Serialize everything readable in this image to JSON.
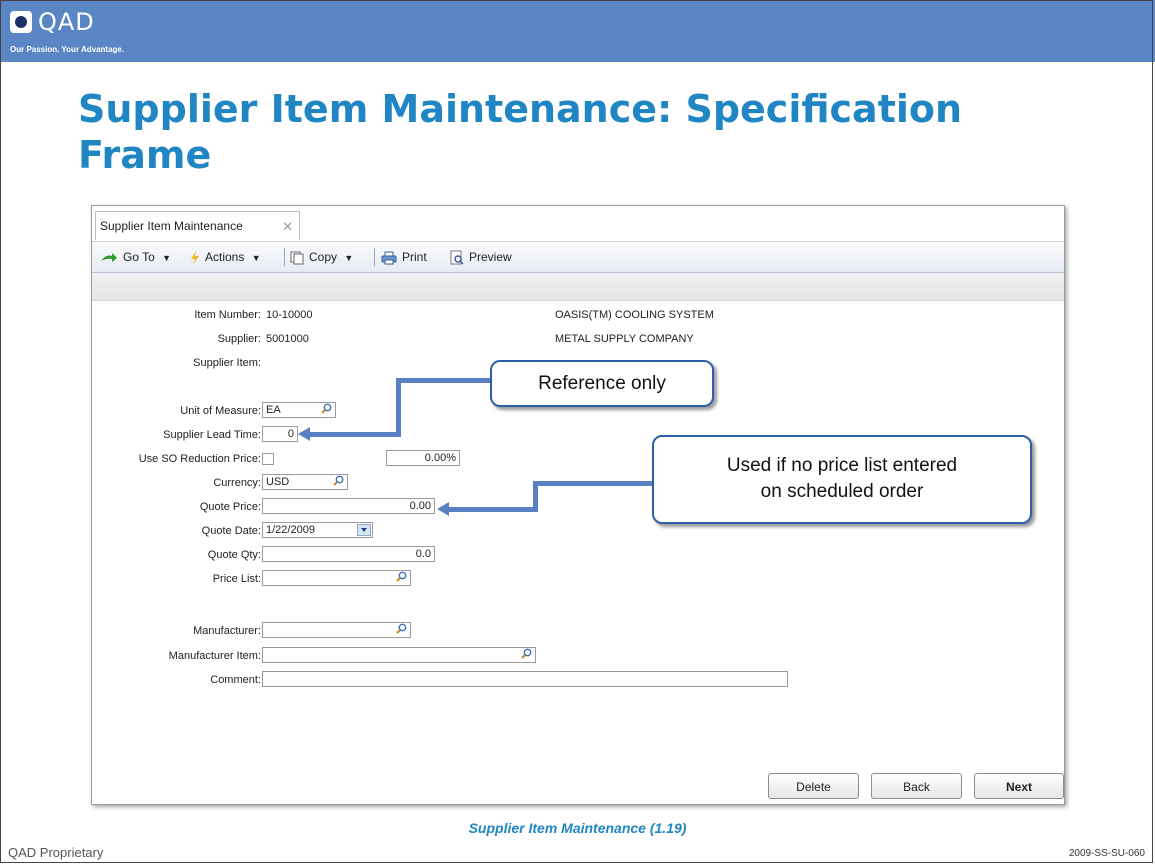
{
  "logo": {
    "name": "QAD",
    "tagline": "Our Passion. Your Advantage."
  },
  "slide_title": "Supplier Item Maintenance: Specification Frame",
  "tab": {
    "label": "Supplier Item Maintenance",
    "close": "✕"
  },
  "toolbar": {
    "goto": "Go To",
    "actions": "Actions",
    "copy": "Copy",
    "print": "Print",
    "preview": "Preview"
  },
  "form": {
    "item_number_label": "Item Number:",
    "item_number_value": "10-10000",
    "item_description": "OASIS(TM) COOLING SYSTEM",
    "supplier_label": "Supplier:",
    "supplier_value": "5001000",
    "supplier_name": "METAL SUPPLY COMPANY",
    "supplier_item_label": "Supplier Item:",
    "uom_label": "Unit of Measure:",
    "uom_value": "EA",
    "lead_time_label": "Supplier Lead Time:",
    "lead_time_value": "0",
    "so_reduction_label": "Use SO Reduction Price:",
    "so_reduction_pct": "0.00%",
    "currency_label": "Currency:",
    "currency_value": "USD",
    "quote_price_label": "Quote Price:",
    "quote_price_value": "0.00",
    "quote_date_label": "Quote Date:",
    "quote_date_value": "1/22/2009",
    "quote_qty_label": "Quote Qty:",
    "quote_qty_value": "0.0",
    "price_list_label": "Price List:",
    "price_list_value": "",
    "manufacturer_label": "Manufacturer:",
    "manufacturer_value": "",
    "manufacturer_item_label": "Manufacturer Item:",
    "manufacturer_item_value": "",
    "comment_label": "Comment:",
    "comment_value": ""
  },
  "buttons": {
    "delete": "Delete",
    "back": "Back",
    "next": "Next"
  },
  "callouts": {
    "reference": "Reference only",
    "price_list_line1": "Used if no price list entered",
    "price_list_line2": "on scheduled order"
  },
  "caption": "Supplier Item Maintenance (1.19)",
  "footer": {
    "left": "QAD Proprietary",
    "right": "2009-SS-SU-060"
  },
  "colors": {
    "accent": "#1f86c3",
    "header_bar": "#5a86c6",
    "callout_border": "#2d5fa8",
    "arrow": "#5880c2"
  }
}
